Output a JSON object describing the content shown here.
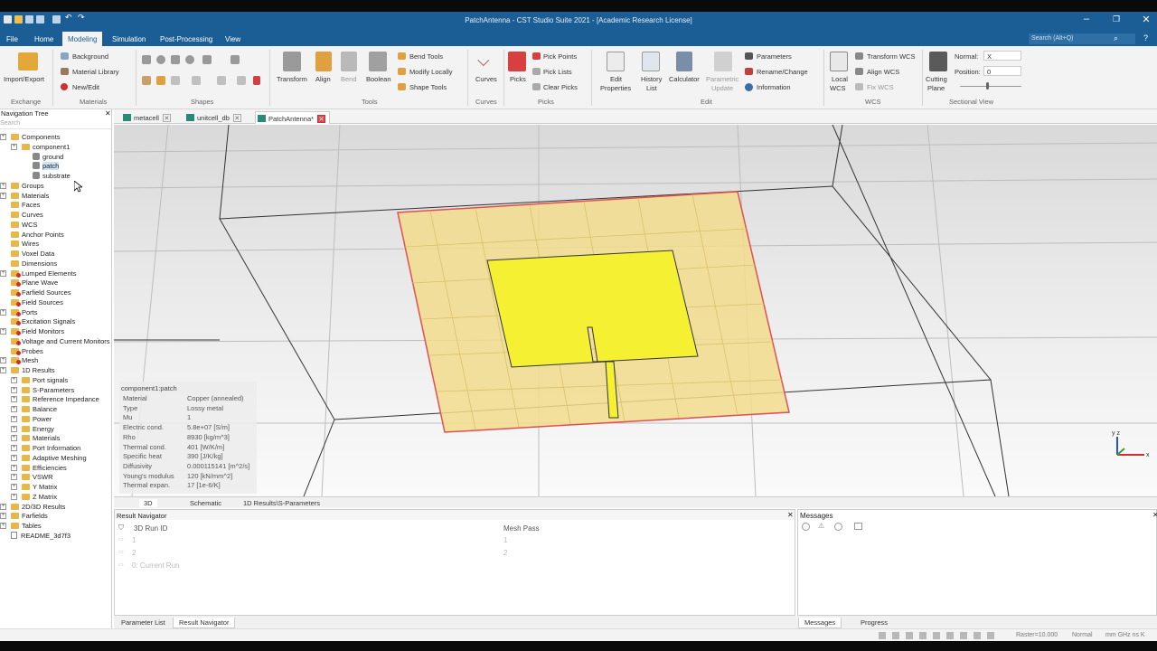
{
  "window": {
    "title": "PatchAntenna - CST Studio Suite 2021 - [Academic Research License]"
  },
  "menu": {
    "items": [
      "File",
      "Home",
      "Modeling",
      "Simulation",
      "Post-Processing",
      "View"
    ],
    "active": "Modeling",
    "search_placeholder": "Search (Alt+Q)"
  },
  "ribbon": {
    "exchange": {
      "import_export": "Import/Export",
      "group": "Exchange"
    },
    "materials": {
      "background": "Background",
      "material_library": "Material Library",
      "new_edit": "New/Edit",
      "group": "Materials"
    },
    "shapes": {
      "group": "Shapes"
    },
    "tools": {
      "transform": "Transform",
      "align": "Align",
      "bend": "Bend",
      "boolean": "Boolean",
      "bend_tools": "Bend Tools",
      "modify_locally": "Modify Locally",
      "shape_tools": "Shape Tools",
      "group": "Tools"
    },
    "curves": {
      "curves": "Curves",
      "group": "Curves"
    },
    "picks": {
      "picks": "Picks",
      "pick_points": "Pick Points",
      "pick_lists": "Pick Lists",
      "clear_picks": "Clear Picks",
      "group": "Picks"
    },
    "edit": {
      "edit_properties_1": "Edit",
      "edit_properties_2": "Properties",
      "history_1": "History",
      "history_2": "List",
      "calculator": "Calculator",
      "parametric_1": "Parametric",
      "parametric_2": "Update",
      "parameters": "Parameters",
      "rename": "Rename/Change",
      "information": "Information",
      "group": "Edit"
    },
    "wcs": {
      "local_1": "Local",
      "local_2": "WCS",
      "transform_wcs": "Transform WCS",
      "align_wcs": "Align WCS",
      "fix_wcs": "Fix WCS",
      "group": "WCS"
    },
    "sectional": {
      "cutting_1": "Cutting",
      "cutting_2": "Plane",
      "normal_label": "Normal:",
      "normal_value": "X",
      "position_label": "Position:",
      "position_value": "0",
      "group": "Sectional View"
    }
  },
  "doc_tabs": [
    {
      "label": "metacell"
    },
    {
      "label": "unitcell_db"
    },
    {
      "label": "PatchAntenna*"
    }
  ],
  "nav": {
    "title": "Navigation Tree",
    "search": "Search",
    "items": [
      {
        "label": "Components"
      },
      {
        "label": "component1"
      },
      {
        "label": "ground"
      },
      {
        "label": "patch"
      },
      {
        "label": "substrate"
      },
      {
        "label": "Groups"
      },
      {
        "label": "Materials"
      },
      {
        "label": "Faces"
      },
      {
        "label": "Curves"
      },
      {
        "label": "WCS"
      },
      {
        "label": "Anchor Points"
      },
      {
        "label": "Wires"
      },
      {
        "label": "Voxel Data"
      },
      {
        "label": "Dimensions"
      },
      {
        "label": "Lumped Elements"
      },
      {
        "label": "Plane Wave"
      },
      {
        "label": "Farfield Sources"
      },
      {
        "label": "Field Sources"
      },
      {
        "label": "Ports"
      },
      {
        "label": "Excitation Signals"
      },
      {
        "label": "Field Monitors"
      },
      {
        "label": "Voltage and Current Monitors"
      },
      {
        "label": "Probes"
      },
      {
        "label": "Mesh"
      },
      {
        "label": "1D Results"
      },
      {
        "label": "Port signals"
      },
      {
        "label": "S-Parameters"
      },
      {
        "label": "Reference Impedance"
      },
      {
        "label": "Balance"
      },
      {
        "label": "Power"
      },
      {
        "label": "Energy"
      },
      {
        "label": "Materials"
      },
      {
        "label": "Port Information"
      },
      {
        "label": "Adaptive Meshing"
      },
      {
        "label": "Efficiencies"
      },
      {
        "label": "VSWR"
      },
      {
        "label": "Y Matrix"
      },
      {
        "label": "Z Matrix"
      },
      {
        "label": "2D/3D Results"
      },
      {
        "label": "Farfields"
      },
      {
        "label": "Tables"
      },
      {
        "label": "README_3d7f3"
      }
    ]
  },
  "info": {
    "title": "component1:patch",
    "rows": [
      {
        "k": "Material",
        "v": "Copper (annealed)"
      },
      {
        "k": "Type",
        "v": "Lossy metal"
      },
      {
        "k": "Mu",
        "v": "1"
      },
      {
        "k": "Electric cond.",
        "v": "5.8e+07 [S/m]"
      },
      {
        "k": "Rho",
        "v": "8930 [kg/m^3]"
      },
      {
        "k": "Thermal cond.",
        "v": "401 [W/K/m]"
      },
      {
        "k": "Specific heat",
        "v": "390 [J/K/kg]"
      },
      {
        "k": "Diffusivity",
        "v": "0.000115141 [m^2/s]"
      },
      {
        "k": "Young's modulus",
        "v": "120 [kN/mm^2]"
      },
      {
        "k": "Thermal expan.",
        "v": "17 [1e-6/K]"
      }
    ]
  },
  "view_tabs": [
    "3D",
    "Schematic",
    "1D Results\\S-Parameters"
  ],
  "result_navigator": {
    "title": "Result Navigator",
    "col1": "3D Run ID",
    "col2": "Mesh Pass",
    "rows": [
      {
        "id": "1",
        "mp": "1"
      },
      {
        "id": "2",
        "mp": "2"
      },
      {
        "id": "0: Current Run",
        "mp": ""
      }
    ]
  },
  "messages": {
    "title": "Messages"
  },
  "bottom_tabs": {
    "left": [
      "Parameter List",
      "Result Navigator"
    ],
    "right": [
      "Messages",
      "Progress"
    ]
  },
  "status": {
    "raster": "Raster=10.000",
    "mode": "Normal",
    "units": "mm  GHz  ns  K"
  },
  "colors": {
    "titlebar": "#1b5e96",
    "substrate": "#f2dc8c",
    "patch": "#f5f032",
    "outline": "#e05050"
  }
}
